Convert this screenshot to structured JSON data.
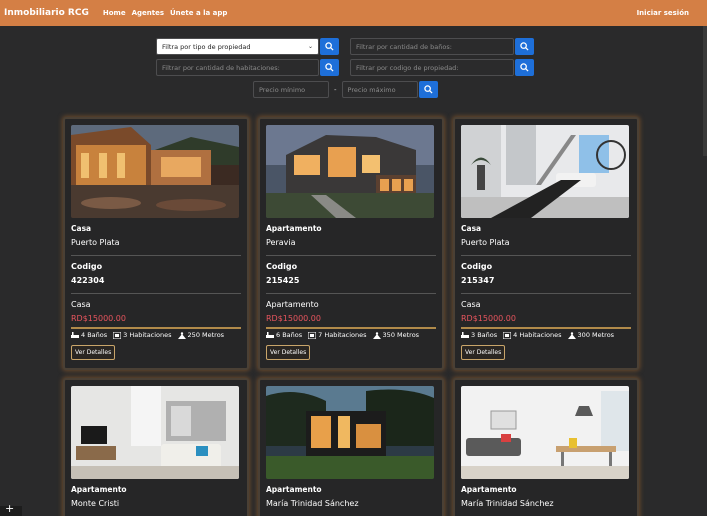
{
  "navbar": {
    "brand": "Inmobiliario RCG",
    "links": [
      "Home",
      "Agentes",
      "Únete a la app"
    ],
    "login": "Iniciar sesión"
  },
  "filters": {
    "type_select": "Filtra por tipo de propiedad",
    "bathrooms_placeholder": "Filtrar por cantidad de baños:",
    "rooms_placeholder": "Filtrar por cantidad de habitaciones:",
    "code_placeholder": "Filtrar por codigo de propiedad:",
    "min_price_placeholder": "Precio mínimo",
    "separator": "-",
    "max_price_placeholder": "Precio máximo"
  },
  "card_labels": {
    "code_label": "Codigo",
    "details_button": "Ver Detalles"
  },
  "properties": [
    {
      "type": "Casa",
      "city": "Puerto Plata",
      "code": "422304",
      "category": "Casa",
      "price": "RD$15000.00",
      "baths": "4 Baños",
      "rooms": "3 Habitaciones",
      "size": "250 Metros"
    },
    {
      "type": "Apartamento",
      "city": "Peravia",
      "code": "215425",
      "category": "Apartamento",
      "price": "RD$15000.00",
      "baths": "6 Baños",
      "rooms": "7 Habitaciones",
      "size": "350 Metros"
    },
    {
      "type": "Casa",
      "city": "Puerto Plata",
      "code": "215347",
      "category": "Casa",
      "price": "RD$15000.00",
      "baths": "3 Baños",
      "rooms": "4 Habitaciones",
      "size": "300 Metros"
    },
    {
      "type": "Apartamento",
      "city": "Monte Cristi"
    },
    {
      "type": "Apartamento",
      "city": "María Trinidad Sánchez"
    },
    {
      "type": "Apartamento",
      "city": "María Trinidad Sánchez"
    }
  ],
  "colors": {
    "navbar": "#d47f45",
    "search_button": "#1e6fd9",
    "price": "#e8555e",
    "card_glow": "#6b4a2a"
  }
}
